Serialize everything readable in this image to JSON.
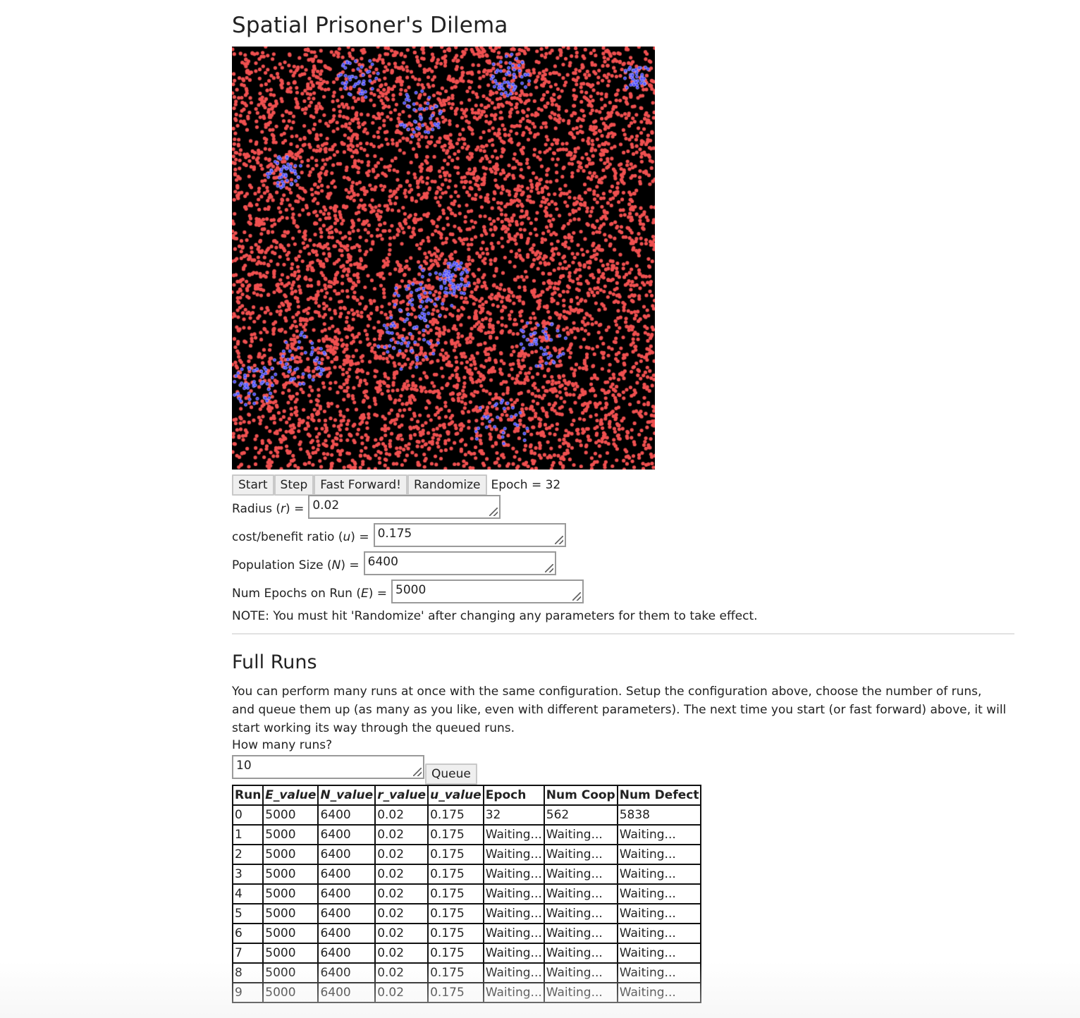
{
  "page": {
    "title": "Spatial Prisoner's Dilema"
  },
  "simulation": {
    "defector_color": "#f05050",
    "cooperator_color": "#4a4aff",
    "background_color": "#000000"
  },
  "controls": {
    "start_label": "Start",
    "step_label": "Step",
    "fast_forward_label": "Fast Forward!",
    "randomize_label": "Randomize",
    "epoch_text": "Epoch = 32"
  },
  "params": {
    "radius": {
      "label_pre": "Radius (",
      "var": "r",
      "label_post": ") =",
      "value": "0.02"
    },
    "cost_benefit": {
      "label_pre": "cost/benefit ratio (",
      "var": "u",
      "label_post": ") =",
      "value": "0.175"
    },
    "population": {
      "label_pre": "Population Size (",
      "var": "N",
      "label_post": ") =",
      "value": "6400"
    },
    "epochs": {
      "label_pre": "Num Epochs on Run (",
      "var": "E",
      "label_post": ") =",
      "value": "5000"
    },
    "note": "NOTE: You must hit 'Randomize' after changing any parameters for them to take effect."
  },
  "full_runs": {
    "heading": "Full Runs",
    "description": "You can perform many runs at once with the same configuration. Setup the configuration above, choose the number of runs, and queue them up (as many as you like, even with different parameters). The next time you start (or fast forward) above, it will start working its way through the queued runs.",
    "how_many_label": "How many runs?",
    "runs_value": "10",
    "queue_label": "Queue"
  },
  "table": {
    "headers": [
      "Run",
      "E_value",
      "N_value",
      "r_value",
      "u_value",
      "Epoch",
      "Num Coop",
      "Num Defect"
    ],
    "rows": [
      [
        "0",
        "5000",
        "6400",
        "0.02",
        "0.175",
        "32",
        "562",
        "5838"
      ],
      [
        "1",
        "5000",
        "6400",
        "0.02",
        "0.175",
        "Waiting...",
        "Waiting...",
        "Waiting..."
      ],
      [
        "2",
        "5000",
        "6400",
        "0.02",
        "0.175",
        "Waiting...",
        "Waiting...",
        "Waiting..."
      ],
      [
        "3",
        "5000",
        "6400",
        "0.02",
        "0.175",
        "Waiting...",
        "Waiting...",
        "Waiting..."
      ],
      [
        "4",
        "5000",
        "6400",
        "0.02",
        "0.175",
        "Waiting...",
        "Waiting...",
        "Waiting..."
      ],
      [
        "5",
        "5000",
        "6400",
        "0.02",
        "0.175",
        "Waiting...",
        "Waiting...",
        "Waiting..."
      ],
      [
        "6",
        "5000",
        "6400",
        "0.02",
        "0.175",
        "Waiting...",
        "Waiting...",
        "Waiting..."
      ],
      [
        "7",
        "5000",
        "6400",
        "0.02",
        "0.175",
        "Waiting...",
        "Waiting...",
        "Waiting..."
      ],
      [
        "8",
        "5000",
        "6400",
        "0.02",
        "0.175",
        "Waiting...",
        "Waiting...",
        "Waiting..."
      ],
      [
        "9",
        "5000",
        "6400",
        "0.02",
        "0.175",
        "Waiting...",
        "Waiting...",
        "Waiting..."
      ]
    ]
  }
}
